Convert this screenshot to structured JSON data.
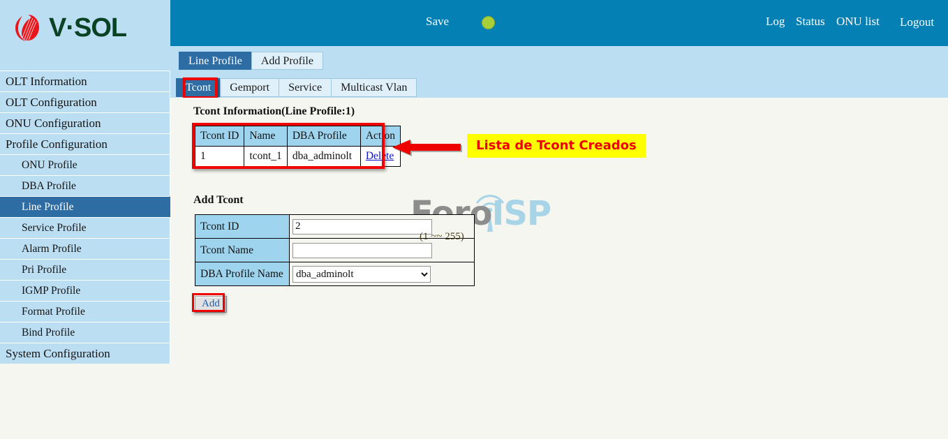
{
  "brand": {
    "logo_icon": "vsol-swirl-logo-icon",
    "name": "V·SOL"
  },
  "topbar": {
    "save_label": "Save",
    "status_dot_icon": "status-indicator-green-icon",
    "status_color": "#a8cf37",
    "links": [
      "Log",
      "Status",
      "ONU list"
    ],
    "logout_label": "Logout",
    "background": "#0580b4"
  },
  "sidebar": {
    "items": [
      {
        "label": "OLT Information",
        "sub": false,
        "active": false
      },
      {
        "label": "OLT Configuration",
        "sub": false,
        "active": false
      },
      {
        "label": "ONU Configuration",
        "sub": false,
        "active": false
      },
      {
        "label": "Profile Configuration",
        "sub": false,
        "active": false
      },
      {
        "label": "ONU Profile",
        "sub": true,
        "active": false
      },
      {
        "label": "DBA Profile",
        "sub": true,
        "active": false
      },
      {
        "label": "Line Profile",
        "sub": true,
        "active": true
      },
      {
        "label": "Service Profile",
        "sub": true,
        "active": false
      },
      {
        "label": "Alarm Profile",
        "sub": true,
        "active": false
      },
      {
        "label": "Pri Profile",
        "sub": true,
        "active": false
      },
      {
        "label": "IGMP Profile",
        "sub": true,
        "active": false
      },
      {
        "label": "Format Profile",
        "sub": true,
        "active": false
      },
      {
        "label": "Bind Profile",
        "sub": true,
        "active": false
      },
      {
        "label": "System Configuration",
        "sub": false,
        "active": false
      }
    ],
    "active_color": "#2e6da4",
    "background": "#bcdef2"
  },
  "tabs_primary": [
    {
      "label": "Line Profile",
      "selected": true
    },
    {
      "label": "Add Profile",
      "selected": false
    }
  ],
  "tabs_secondary": [
    {
      "label": "Tcont",
      "selected": true
    },
    {
      "label": "Gemport",
      "selected": false
    },
    {
      "label": "Service",
      "selected": false
    },
    {
      "label": "Multicast Vlan",
      "selected": false
    }
  ],
  "main": {
    "info_title": "Tcont Information(Line Profile:1)",
    "table": {
      "headers": [
        "Tcont ID",
        "Name",
        "DBA Profile",
        "Action"
      ],
      "rows": [
        {
          "tcont_id": "1",
          "name": "tcont_1",
          "dba_profile": "dba_adminolt",
          "action": "Delete"
        }
      ]
    },
    "add_title": "Add Tcont",
    "form": {
      "tcont_id_label": "Tcont ID",
      "tcont_id_value": "2",
      "tcont_id_hint": "(1 ~~ 255)",
      "tcont_name_label": "Tcont Name",
      "tcont_name_value": "",
      "tcont_name_placeholder": "",
      "dba_profile_label": "DBA Profile Name",
      "dba_profile_value": "dba_adminolt",
      "dba_profile_options": [
        "dba_adminolt"
      ]
    },
    "add_button_label": "Add"
  },
  "annotations": {
    "color": "#f10000",
    "highlight_background": "#ffff00",
    "arrow_icon": "left-arrow-annotation-icon",
    "callout_text": "Lista de Tcont Creados",
    "boxed_elements": [
      "tcont-tab",
      "tcont-info-table",
      "add-button"
    ]
  },
  "watermark": {
    "text_primary": "Foro",
    "text_secondary": "ISP",
    "antenna_icon": "wifi-antenna-icon",
    "color_primary": "#8d8d8d",
    "color_secondary": "#a8d4e8"
  }
}
